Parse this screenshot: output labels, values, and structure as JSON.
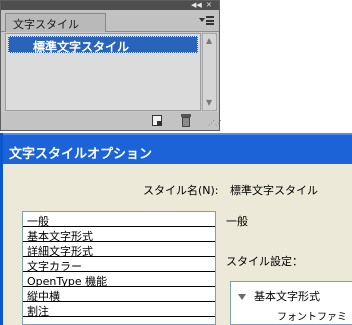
{
  "panel": {
    "tab_label": "文字スタイル",
    "selected_style": "標準文字スタイル"
  },
  "dialog": {
    "title": "文字スタイルオプション",
    "style_name_label": "スタイル名(N):",
    "style_name_value": "標準文字スタイル",
    "categories": [
      "一般",
      "基本文字形式",
      "詳細文字形式",
      "文字カラー",
      "OpenType 機能",
      "縦中横",
      "割注"
    ],
    "section_title": "一般",
    "settings_label": "スタイル設定：",
    "tree": {
      "parent": "基本文字形式",
      "child": "フォントファミリ(F)"
    }
  }
}
